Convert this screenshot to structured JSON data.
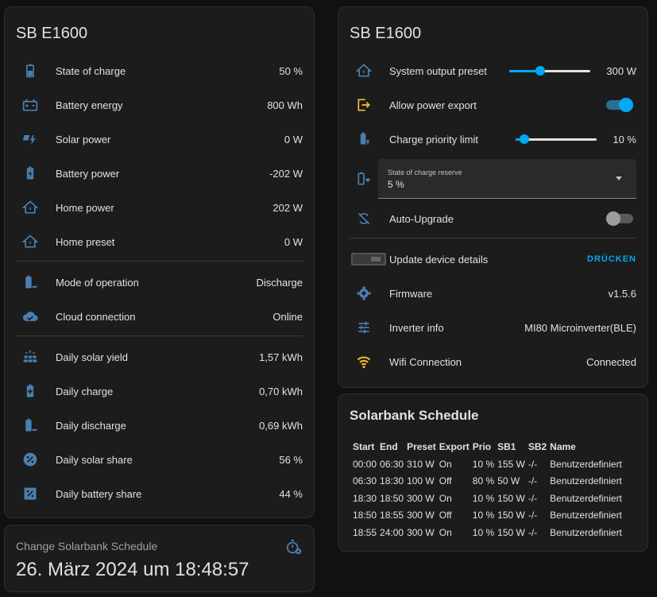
{
  "left_card": {
    "title": "SB E1600",
    "rows_a": [
      {
        "label": "State of charge",
        "value": "50 %",
        "icon": "battery-half-icon"
      },
      {
        "label": "Battery energy",
        "value": "800 Wh",
        "icon": "car-battery-icon"
      },
      {
        "label": "Solar power",
        "value": "0 W",
        "icon": "solar-power-icon"
      },
      {
        "label": "Battery power",
        "value": "-202 W",
        "icon": "battery-charging-icon"
      },
      {
        "label": "Home power",
        "value": "202 W",
        "icon": "home-lightning-icon"
      },
      {
        "label": "Home preset",
        "value": "0 W",
        "icon": "home-lightning-icon"
      }
    ],
    "rows_b": [
      {
        "label": "Mode of operation",
        "value": "Discharge",
        "icon": "battery-minus-icon"
      },
      {
        "label": "Cloud connection",
        "value": "Online",
        "icon": "cloud-check-icon"
      }
    ],
    "rows_c": [
      {
        "label": "Daily solar yield",
        "value": "1,57 kWh",
        "icon": "solar-panel-icon"
      },
      {
        "label": "Daily charge",
        "value": "0,70 kWh",
        "icon": "battery-plus-icon"
      },
      {
        "label": "Daily discharge",
        "value": "0,69 kWh",
        "icon": "battery-minus-icon"
      },
      {
        "label": "Daily solar share",
        "value": "56 %",
        "icon": "percent-circle-icon"
      },
      {
        "label": "Daily battery share",
        "value": "44 %",
        "icon": "percent-box-icon"
      }
    ]
  },
  "schedule_change": {
    "title": "Change Solarbank Schedule",
    "datetime": "26. März 2024 um 18:48:57",
    "icon": "timer-cog-icon"
  },
  "right_card": {
    "title": "SB E1600",
    "output_preset": {
      "label": "System output preset",
      "value": "300 W",
      "slider_fraction": 0.38
    },
    "allow_export": {
      "label": "Allow power export",
      "on": true
    },
    "charge_priority": {
      "label": "Charge priority limit",
      "value": "10 %",
      "slider_fraction": 0.1
    },
    "soc_reserve": {
      "label": "State of charge reserve",
      "value": "5 %"
    },
    "auto_upgrade": {
      "label": "Auto-Upgrade",
      "on": false
    },
    "update_details": {
      "label": "Update device details",
      "action": "DRÜCKEN"
    },
    "firmware": {
      "label": "Firmware",
      "value": "v1.5.6"
    },
    "inverter": {
      "label": "Inverter info",
      "value": "MI80 Microinverter(BLE)"
    },
    "wifi": {
      "label": "Wifi Connection",
      "value": "Connected"
    }
  },
  "schedule": {
    "title": "Solarbank Schedule",
    "headers": [
      "Start",
      "End",
      "Preset",
      "Export",
      "Prio",
      "SB1",
      "SB2",
      "Name"
    ],
    "rows": [
      [
        "00:00",
        "06:30",
        "310 W",
        "On",
        "10 %",
        "155 W",
        "-/-",
        "Benutzerdefiniert"
      ],
      [
        "06:30",
        "18:30",
        "100 W",
        "Off",
        "80 %",
        "50 W",
        "-/-",
        "Benutzerdefiniert"
      ],
      [
        "18:30",
        "18:50",
        "300 W",
        "On",
        "10 %",
        "150 W",
        "-/-",
        "Benutzerdefiniert"
      ],
      [
        "18:50",
        "18:55",
        "300 W",
        "Off",
        "10 %",
        "150 W",
        "-/-",
        "Benutzerdefiniert"
      ],
      [
        "18:55",
        "24:00",
        "300 W",
        "On",
        "10 %",
        "150 W",
        "-/-",
        "Benutzerdefiniert"
      ]
    ]
  },
  "colors": {
    "icon_blue": "#4a7fb0",
    "accent": "#03a9f4",
    "yellow": "#fbc02d",
    "bg": "#111111",
    "card": "#1c1c1c"
  }
}
